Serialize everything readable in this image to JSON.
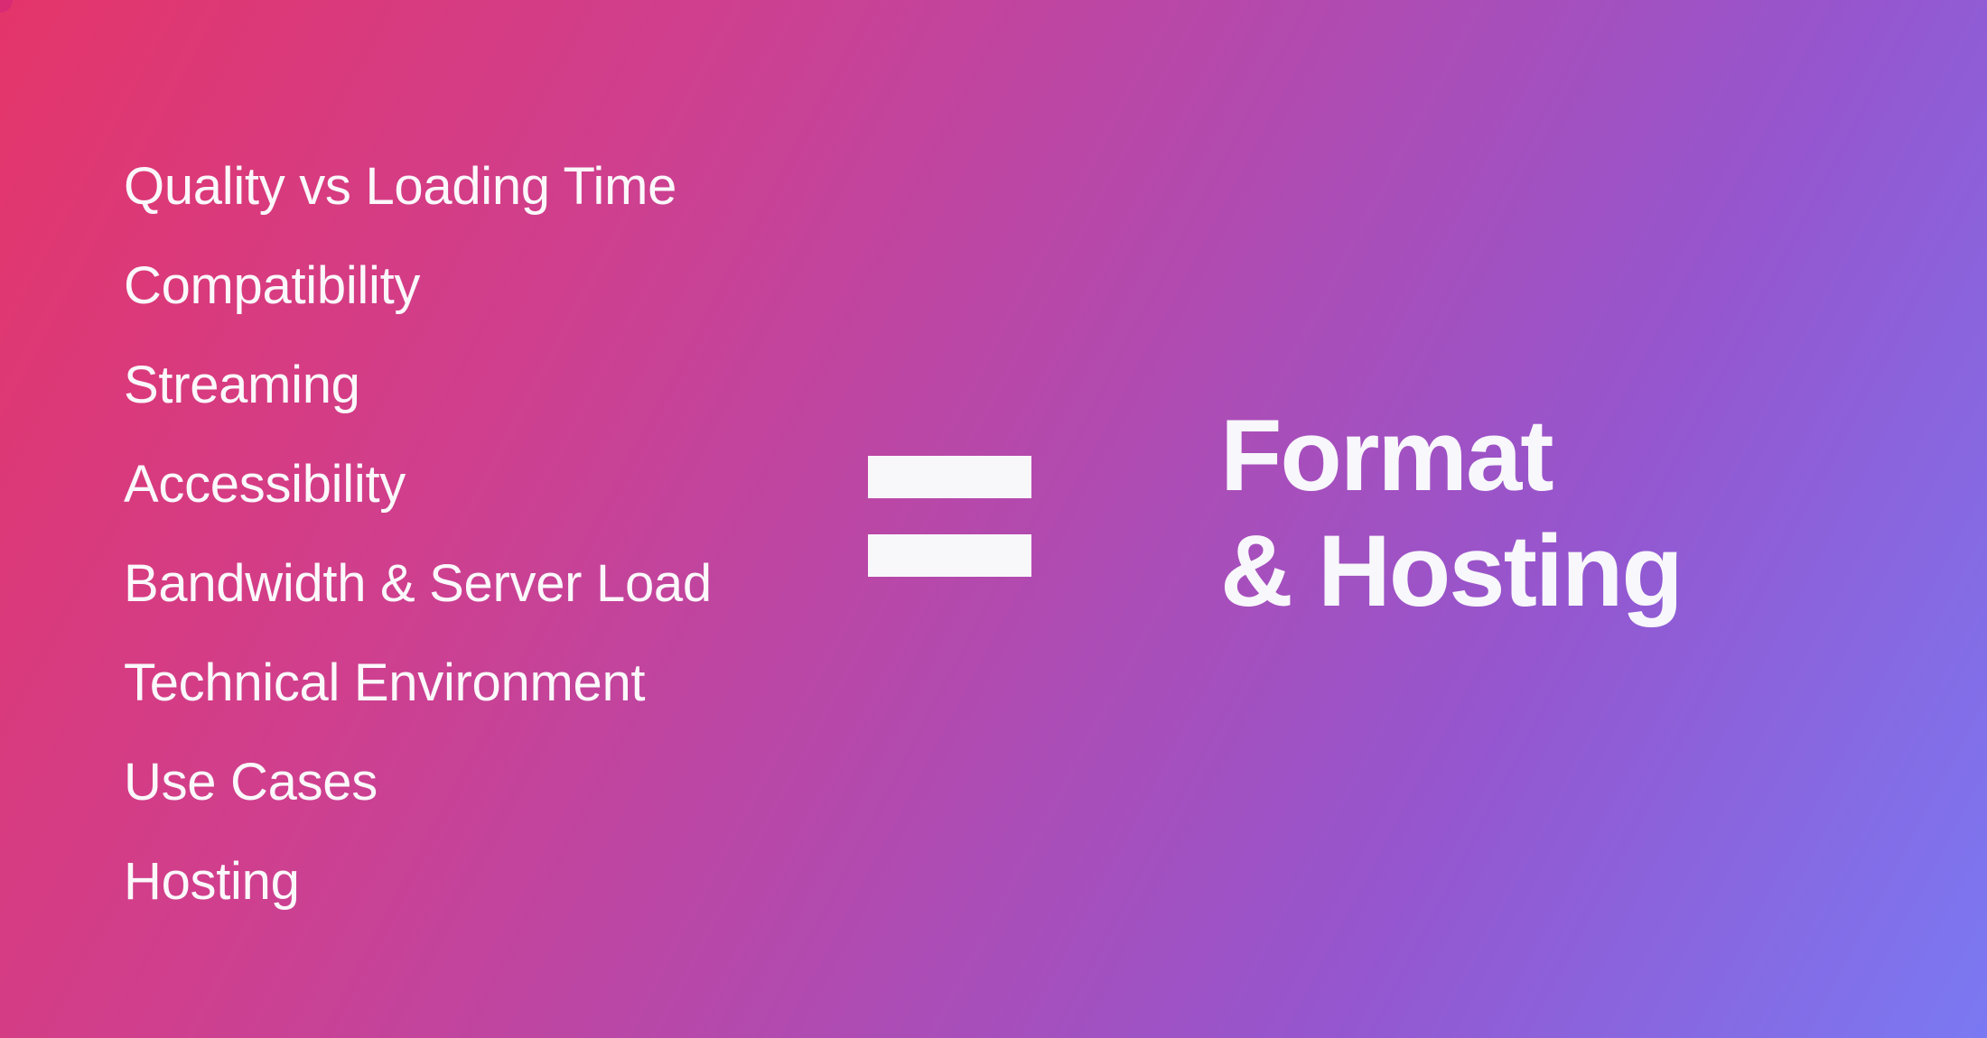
{
  "slide": {
    "background_gradient": [
      "#e4356a",
      "#b24aaf",
      "#7a79f2"
    ],
    "topics": [
      "Quality vs Loading Time",
      "Compatibility",
      "Streaming",
      "Accessibility",
      "Bandwidth & Server Load",
      "Technical Environment",
      "Use Cases",
      "Hosting"
    ],
    "equals_symbol": "equals-icon",
    "title": {
      "line1": "Format",
      "line2": "& Hosting"
    }
  }
}
